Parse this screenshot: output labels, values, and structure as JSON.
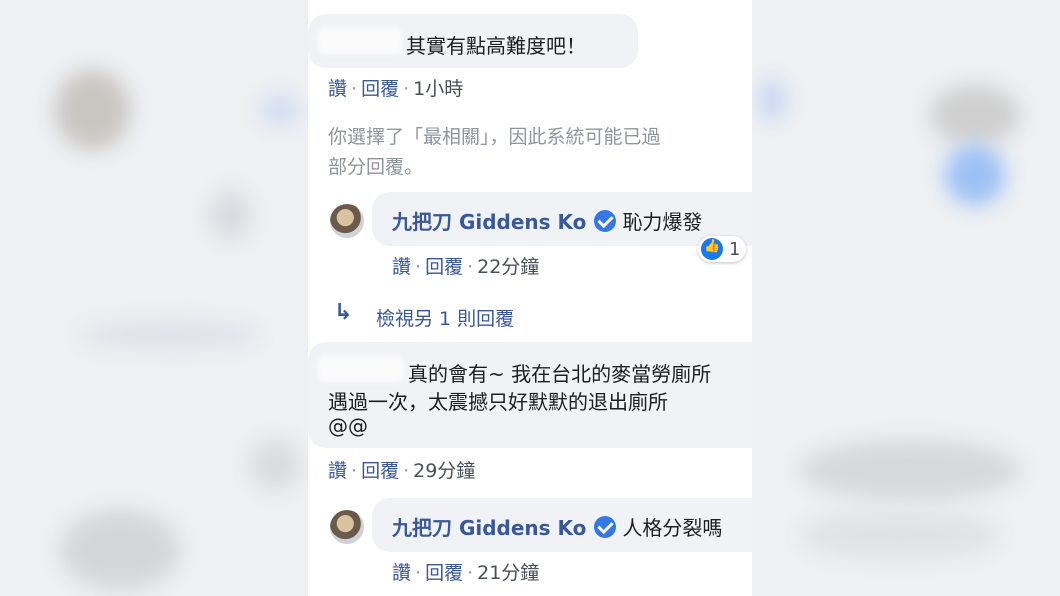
{
  "comments": [
    {
      "text": "其實有點高難度吧！",
      "like": "讚",
      "reply": "回覆",
      "time": "1小時"
    },
    {
      "text": "真的會有~ 我在台北的麥當勞廁所",
      "text2": "遇過一次，太震撼只好默默的退出廁所",
      "text3": "@@",
      "like": "讚",
      "reply": "回覆",
      "time": "29分鐘"
    }
  ],
  "notice": {
    "line1": "你選擇了「最相關」，因此系統可能已過",
    "line2": "部分回覆。"
  },
  "replies": [
    {
      "author": "九把刀 Giddens Ko",
      "text": "恥力爆發",
      "like": "讚",
      "reply": "回覆",
      "time": "22分鐘",
      "reaction_count": "1"
    },
    {
      "author": "九把刀 Giddens Ko",
      "text": "人格分裂嗎",
      "like": "讚",
      "reply": "回覆",
      "time": "21分鐘"
    }
  ],
  "view_more": "檢視另 1 則回覆",
  "colors": {
    "link": "#385898",
    "bubble": "#f0f2f5",
    "verified": "#3578e5"
  }
}
